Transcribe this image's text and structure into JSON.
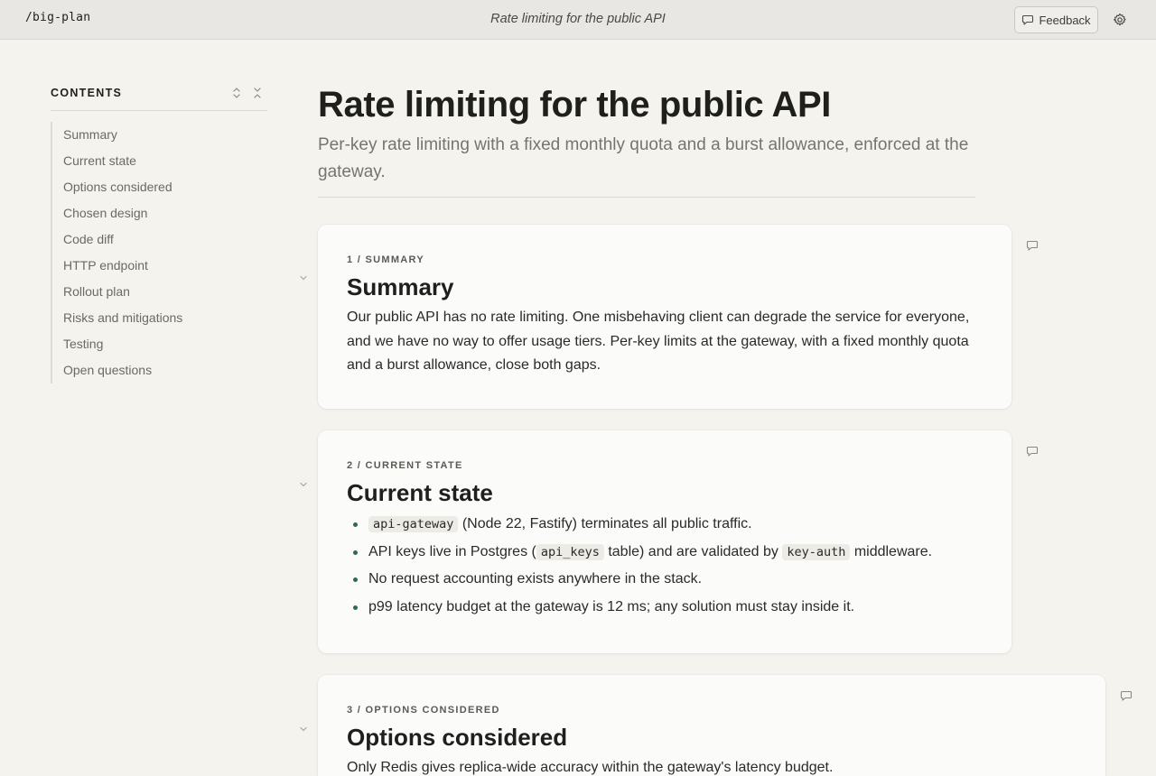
{
  "topbar": {
    "brand": "/big-plan",
    "title": "Rate limiting for the public API",
    "feedback_label": "Feedback",
    "icons": [
      "comment-icon",
      "gear-icon"
    ]
  },
  "sidebar": {
    "title": "CONTENTS",
    "tools": [
      "expand-all-icon",
      "collapse-all-icon"
    ],
    "items": [
      {
        "label": "Summary"
      },
      {
        "label": "Current state"
      },
      {
        "label": "Options considered"
      },
      {
        "label": "Chosen design"
      },
      {
        "label": "Code diff"
      },
      {
        "label": "HTTP endpoint"
      },
      {
        "label": "Rollout plan"
      },
      {
        "label": "Risks and mitigations"
      },
      {
        "label": "Testing"
      },
      {
        "label": "Open questions"
      }
    ]
  },
  "page": {
    "title": "Rate limiting for the public API",
    "subtitle": "Per-key rate limiting with a fixed monthly quota and a burst allowance, enforced at the gateway."
  },
  "sections": [
    {
      "eyebrow": "1 / SUMMARY",
      "title": "Summary",
      "body": "Our public API has no rate limiting. One misbehaving client can degrade the service for everyone, and we have no way to offer usage tiers. Per-key limits at the gateway, with a fixed monthly quota and a burst allowance, close both gaps."
    },
    {
      "eyebrow": "2 / CURRENT STATE",
      "title": "Current state",
      "bullets": [
        {
          "code": "api-gateway",
          "text": " (Node 22, Fastify) terminates all public traffic."
        },
        {
          "pre": "API keys live in Postgres (",
          "code": "api_keys",
          "mid": " table) and are validated by ",
          "code2": "key-auth",
          "post": " middleware."
        },
        {
          "text": "No request accounting exists anywhere in the stack."
        },
        {
          "text": "p99 latency budget at the gateway is 12 ms; any solution must stay inside it."
        }
      ]
    },
    {
      "eyebrow": "3 / OPTIONS CONSIDERED",
      "title": "Options considered",
      "body": "Only Redis gives replica-wide accuracy within the gateway's latency budget."
    }
  ],
  "colors": {
    "background": "#f4f3ee",
    "topbar": "#e8e7e3",
    "card": "#fbfbf9",
    "bullet": "#2f6a4f"
  }
}
